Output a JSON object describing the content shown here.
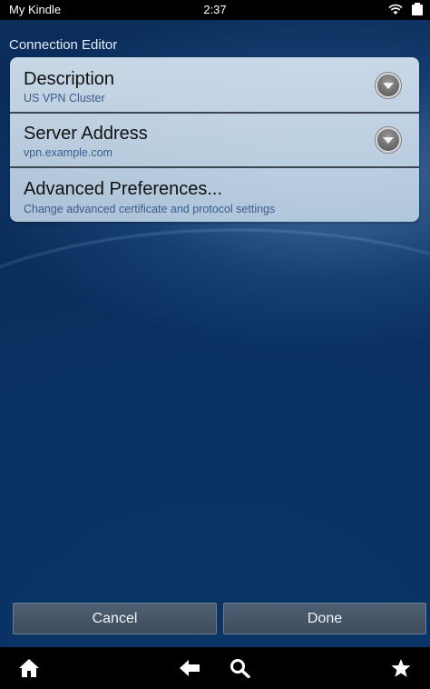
{
  "status_bar": {
    "title": "My Kindle",
    "time": "2:37"
  },
  "screen": {
    "title": "Connection Editor"
  },
  "settings": [
    {
      "title": "Description",
      "value": "US VPN Cluster",
      "icon": "dropdown-icon"
    },
    {
      "title": "Server Address",
      "value": "vpn.example.com",
      "icon": "dropdown-icon"
    },
    {
      "title": "Advanced Preferences...",
      "value": "Change advanced certificate and protocol settings"
    }
  ],
  "buttons": {
    "cancel": "Cancel",
    "done": "Done"
  },
  "nav": {
    "icons": [
      "home-icon",
      "back-icon",
      "search-icon",
      "favorites-icon"
    ]
  },
  "colors": {
    "background": "#0b3566",
    "panel": "#d6e4f0",
    "subtext": "#3a5c8e",
    "button": "#45566a"
  }
}
